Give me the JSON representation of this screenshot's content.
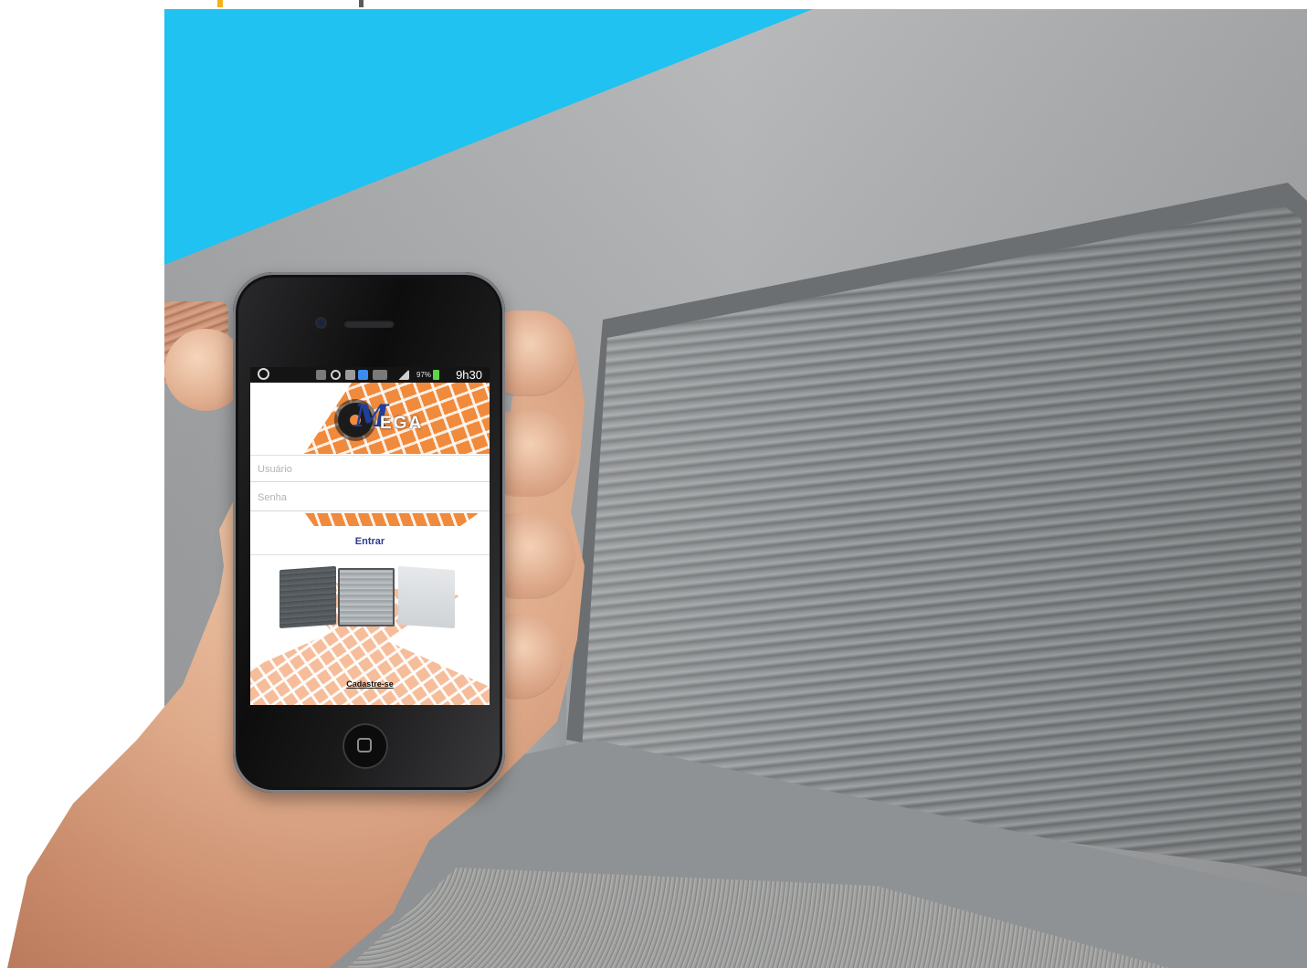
{
  "status_bar": {
    "battery_percent": "97%",
    "time": "9h30"
  },
  "banner": {
    "logo_text": "EGA"
  },
  "login": {
    "username_placeholder": "Usuário",
    "password_placeholder": "Senha",
    "enter_label": "Entrar",
    "register_label": "Cadastre-se"
  },
  "colors": {
    "sky": "#1fc2f0",
    "brand_orange": "#f08a3c",
    "brand_blue": "#1f3f9a",
    "enter_text": "#2a3c8f"
  }
}
